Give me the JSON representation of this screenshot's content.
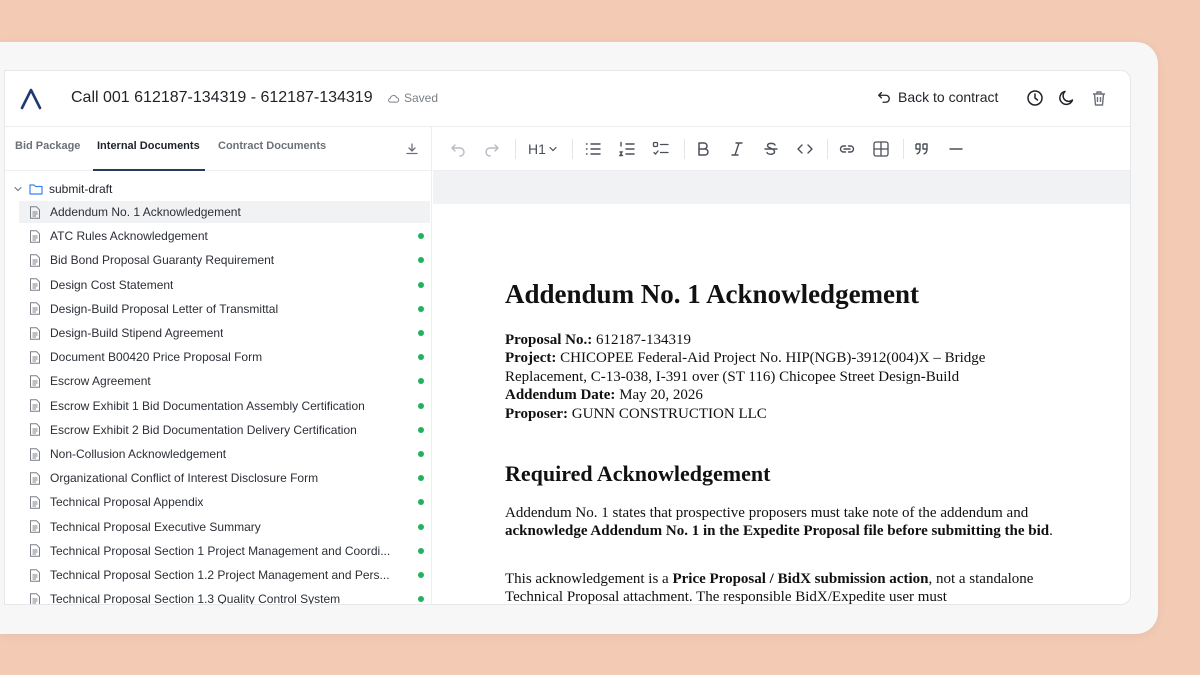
{
  "header": {
    "title": "Call 001 612187-134319 - 612187-134319",
    "saved_label": "Saved",
    "back_label": "Back to contract"
  },
  "tabs": [
    {
      "label": "Bid Package"
    },
    {
      "label": "Internal Documents"
    },
    {
      "label": "Contract Documents"
    }
  ],
  "active_tab": "Internal Documents",
  "tree": {
    "folder": "submit-draft",
    "files": [
      {
        "name": "Addendum No. 1 Acknowledgement",
        "status": false,
        "selected": true
      },
      {
        "name": "ATC Rules Acknowledgement",
        "status": true
      },
      {
        "name": "Bid Bond Proposal Guaranty Requirement",
        "status": true
      },
      {
        "name": "Design Cost Statement",
        "status": true
      },
      {
        "name": "Design-Build Proposal Letter of Transmittal",
        "status": true
      },
      {
        "name": "Design-Build Stipend Agreement",
        "status": true
      },
      {
        "name": "Document B00420 Price Proposal Form",
        "status": true
      },
      {
        "name": "Escrow Agreement",
        "status": true
      },
      {
        "name": "Escrow Exhibit 1 Bid Documentation Assembly Certification",
        "status": true
      },
      {
        "name": "Escrow Exhibit 2 Bid Documentation Delivery Certification",
        "status": true
      },
      {
        "name": "Non-Collusion Acknowledgement",
        "status": true
      },
      {
        "name": "Organizational Conflict of Interest Disclosure Form",
        "status": true
      },
      {
        "name": "Technical Proposal Appendix",
        "status": true
      },
      {
        "name": "Technical Proposal Executive Summary",
        "status": true
      },
      {
        "name": "Technical Proposal Section 1 Project Management and Coordi...",
        "status": true
      },
      {
        "name": "Technical Proposal Section 1.2 Project Management and Pers...",
        "status": true
      },
      {
        "name": "Technical Proposal Section 1.3 Quality Control System",
        "status": true
      }
    ]
  },
  "toolbar": {
    "heading_label": "H1",
    "icons": [
      "undo-icon",
      "redo-icon",
      "bullet-list-icon",
      "ordered-list-icon",
      "task-list-icon",
      "bold-icon",
      "italic-icon",
      "strikethrough-icon",
      "code-icon",
      "link-icon",
      "table-icon",
      "quote-icon",
      "horizontal-rule-icon"
    ]
  },
  "document": {
    "title": "Addendum No. 1 Acknowledgement",
    "proposal_no_label": "Proposal No.:",
    "proposal_no": " 612187-134319",
    "project_label": "Project:",
    "project": " CHICOPEE Federal-Aid Project No. HIP(NGB)-3912(004)X – Bridge Replacement, C-13-038, I-391 over (ST 116) Chicopee Street Design-Build",
    "addendum_date_label": "Addendum Date:",
    "addendum_date": " May 20, 2026",
    "proposer_label": "Proposer:",
    "proposer": " GUNN CONSTRUCTION LLC",
    "section_heading": "Required Acknowledgement",
    "para1_text": "Addendum No. 1 states that prospective proposers must take note of the addendum and ",
    "para1_bold": "acknowledge Addendum No. 1 in the Expedite Proposal file before submitting the bid",
    "para1_end": ".",
    "para2_text": "This acknowledgement is a ",
    "para2_bold": "Price Proposal / BidX submission action",
    "para2_end": ", not a standalone Technical Proposal attachment. The responsible BidX/Expedite user must"
  },
  "colors": {
    "background": "#f3cbb5",
    "status_dot": "#21b35b",
    "logo": "#1e3a6e"
  }
}
